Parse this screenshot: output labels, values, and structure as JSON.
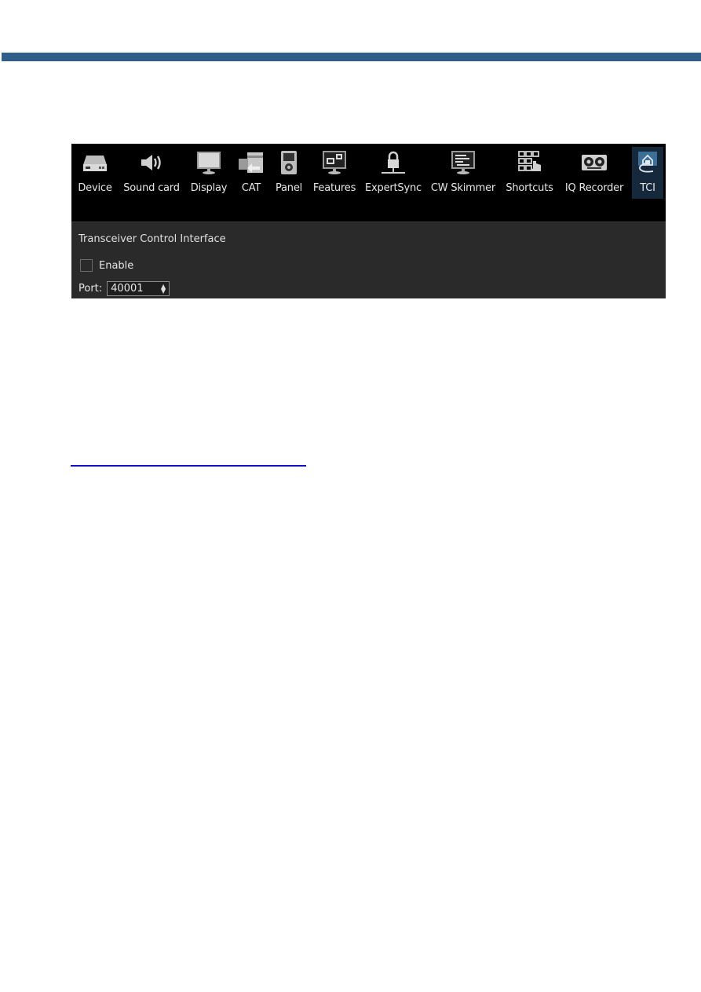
{
  "page": {
    "header_bar_color": "#2f5e88",
    "link_underline_color": "#1010c0"
  },
  "toolbar": {
    "items": [
      {
        "label": "Device",
        "icon": "device-icon",
        "active": false
      },
      {
        "label": "Sound card",
        "icon": "speaker-icon",
        "active": false
      },
      {
        "label": "Display",
        "icon": "monitor-icon",
        "active": false
      },
      {
        "label": "CAT",
        "icon": "cat-icon",
        "active": false
      },
      {
        "label": "Panel",
        "icon": "panel-icon",
        "active": false
      },
      {
        "label": "Features",
        "icon": "features-icon",
        "active": false
      },
      {
        "label": "ExpertSync",
        "icon": "lock-network-icon",
        "active": false
      },
      {
        "label": "CW Skimmer",
        "icon": "cw-skimmer-icon",
        "active": false
      },
      {
        "label": "Shortcuts",
        "icon": "keypad-icon",
        "active": false
      },
      {
        "label": "IQ Recorder",
        "icon": "tape-recorder-icon",
        "active": true
      },
      {
        "label": "TCI",
        "icon": "tci-icon",
        "active": true
      }
    ]
  },
  "panel": {
    "title": "Transceiver Control Interface",
    "enable_label": "Enable",
    "enable_checked": false,
    "port_label": "Port:",
    "port_value": "40001"
  }
}
